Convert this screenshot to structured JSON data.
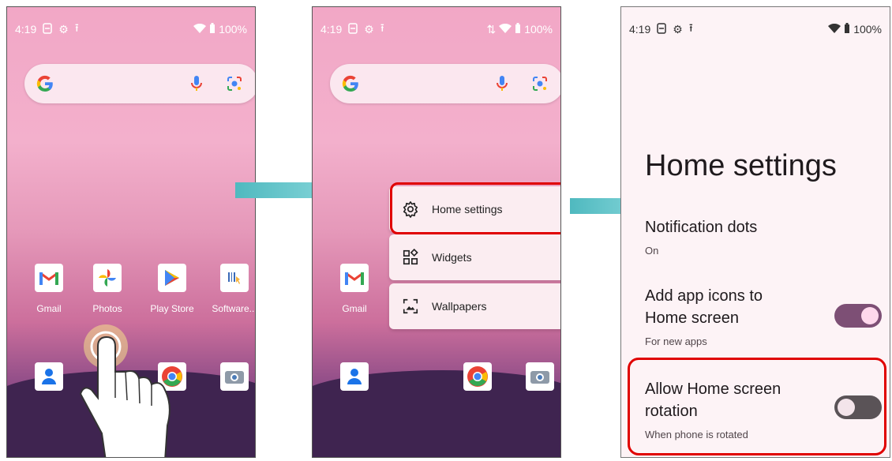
{
  "status": {
    "time": "4:19",
    "battery": "100%"
  },
  "screen1": {
    "apps_row1": [
      {
        "label": "Gmail",
        "icon": "gmail-icon"
      },
      {
        "label": "Photos",
        "icon": "photos-icon"
      },
      {
        "label": "Play Store",
        "icon": "play-store-icon"
      },
      {
        "label": "Software...",
        "icon": "software-icon"
      }
    ],
    "apps_row2": [
      "contacts-icon",
      "chrome-icon",
      "camera-icon"
    ]
  },
  "screen2": {
    "menu": [
      {
        "label": "Home settings",
        "icon": "gear-icon"
      },
      {
        "label": "Widgets",
        "icon": "widgets-icon"
      },
      {
        "label": "Wallpapers",
        "icon": "wallpapers-icon"
      }
    ],
    "gmail_label": "Gmail"
  },
  "screen3": {
    "title": "Home settings",
    "notification_dots": {
      "title": "Notification dots",
      "summary": "On"
    },
    "add_icons": {
      "title_line1": "Add app icons to",
      "title_line2": "Home screen",
      "summary": "For new apps",
      "enabled": true
    },
    "rotation": {
      "title_line1": "Allow Home screen",
      "title_line2": "rotation",
      "summary": "When phone is rotated",
      "enabled": false
    }
  },
  "colors": {
    "highlight": "#e00000",
    "arrow": "#6cc8cc",
    "toggle_on": "#7d4f75",
    "toggle_off": "#5a5357"
  }
}
